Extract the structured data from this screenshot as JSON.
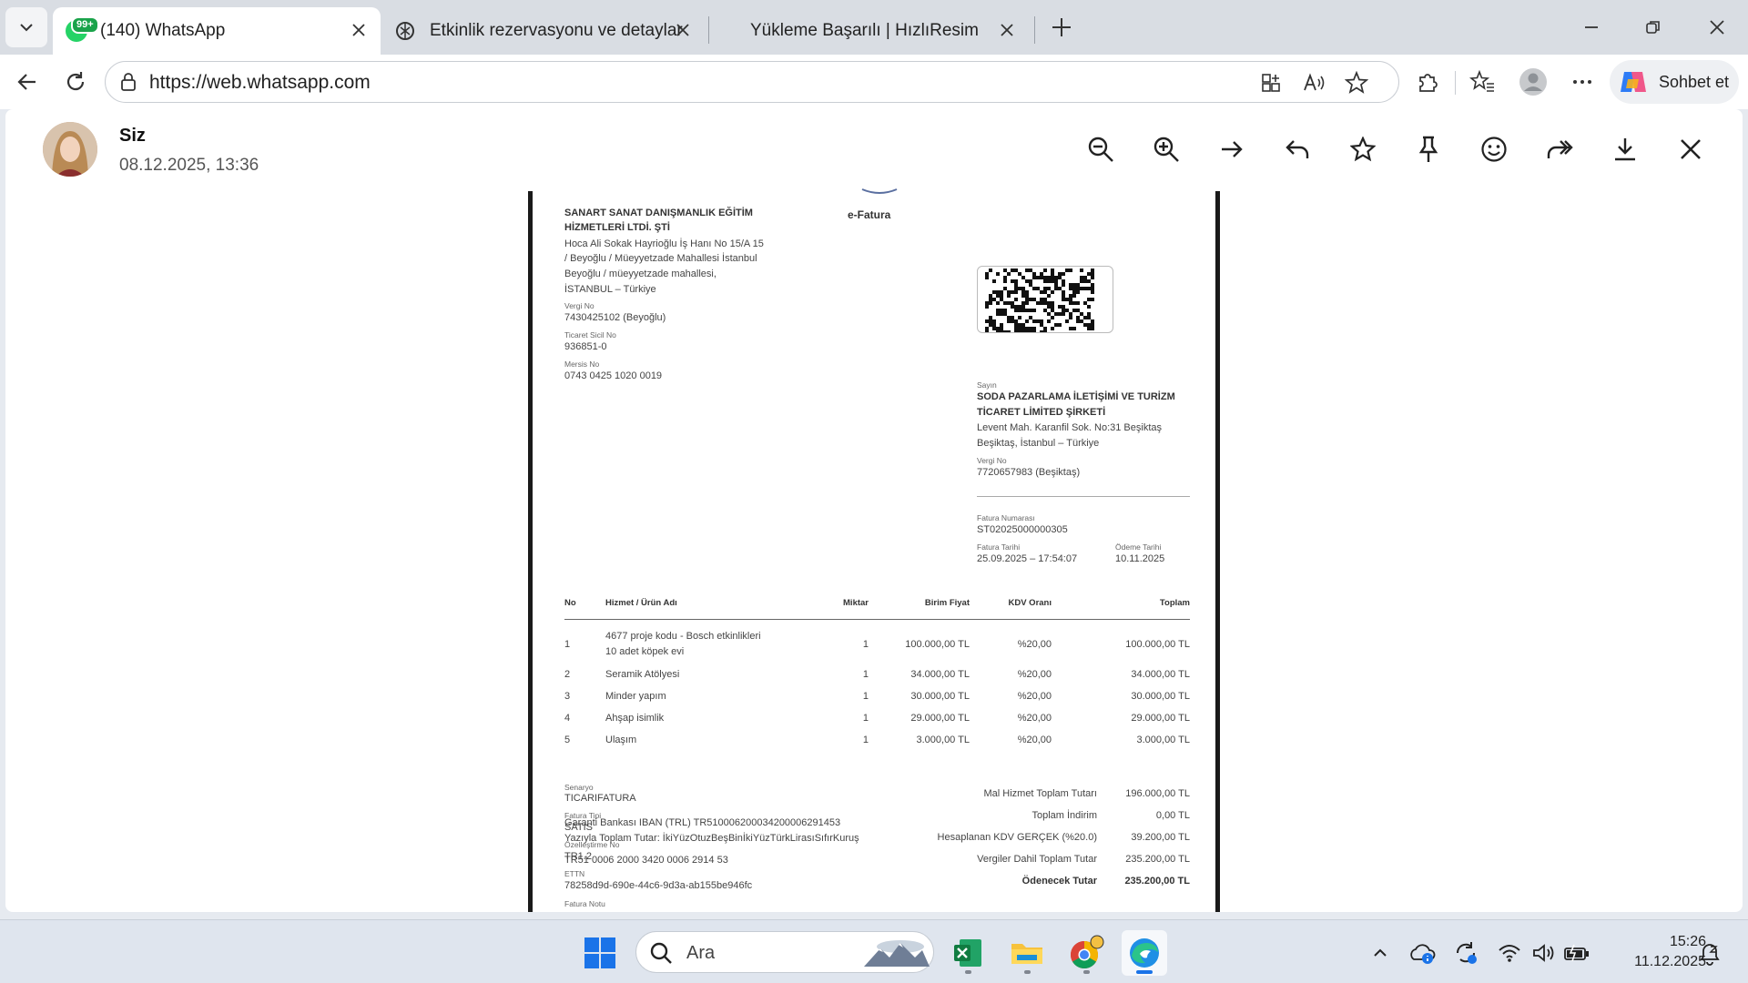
{
  "browser": {
    "tabs": [
      {
        "label": "(140) WhatsApp",
        "badge": "99+",
        "active": true
      },
      {
        "label": "Etkinlik rezervasyonu ve detaylar",
        "active": false
      },
      {
        "label": "Yükleme Başarılı | HızlıResim",
        "active": false
      }
    ],
    "url": "https://web.whatsapp.com",
    "copilot_label": "Sohbet et"
  },
  "viewer": {
    "sender": "Siz",
    "timestamp": "08.12.2025, 13:36"
  },
  "invoice": {
    "seller_lines": [
      "SANART SANAT DANIŞMANLIK EĞİTİM",
      "HİZMETLERİ LTDİ. ŞTİ"
    ],
    "seller_address": [
      "Hoca Ali Sokak Hayrioğlu İş Hanı No 15/A 15",
      "/ Beyoğlu / Müeyyetzade Mahallesi İstanbul",
      "Beyoğlu / müeyyetzade mahallesi,",
      "İSTANBUL – Türkiye"
    ],
    "vergi_no_label": "Vergi No",
    "vergi_no": "7430425102 (Beyoğlu)",
    "ticaret_label": "Ticaret Sicil No",
    "ticaret": "936851-0",
    "mersis_label": "Mersis No",
    "mersis": "0743 0425 1020 0019",
    "efatura": "e-Fatura",
    "sayin_label": "Sayın",
    "buyer_lines": [
      "SODA PAZARLAMA İLETİŞİMİ VE TURİZM",
      "TİCARET LİMİTED ŞİRKETİ"
    ],
    "buyer_address": [
      "Levent Mah. Karanfil Sok. No:31 Beşiktaş",
      "Beşiktaş, İstanbul – Türkiye"
    ],
    "buyer_vergi_label": "Vergi No",
    "buyer_vergi": "7720657983 (Beşiktaş)",
    "fatura_no_label": "Fatura Numarası",
    "fatura_no": "ST02025000000305",
    "fatura_tarihi_label": "Fatura Tarihi",
    "fatura_tarihi": "25.09.2025 – 17:54:07",
    "odeme_label": "Ödeme Tarihi",
    "odeme": "10.11.2025",
    "columns": [
      "No",
      "Hizmet / Ürün Adı",
      "Miktar",
      "Birim Fiyat",
      "KDV Oranı",
      "Toplam"
    ],
    "rows": [
      {
        "no": "1",
        "name": "4677 proje kodu - Bosch etkinlikleri",
        "name2": "10 adet köpek evi",
        "qty": "1",
        "price": "100.000,00 TL",
        "kdv": "%20,00",
        "total": "100.000,00 TL"
      },
      {
        "no": "2",
        "name": "Seramik Atölyesi",
        "name2": "",
        "qty": "1",
        "price": "34.000,00 TL",
        "kdv": "%20,00",
        "total": "34.000,00 TL"
      },
      {
        "no": "3",
        "name": "Minder yapım",
        "name2": "",
        "qty": "1",
        "price": "30.000,00 TL",
        "kdv": "%20,00",
        "total": "30.000,00 TL"
      },
      {
        "no": "4",
        "name": "Ahşap isimlik",
        "name2": "",
        "qty": "1",
        "price": "29.000,00 TL",
        "kdv": "%20,00",
        "total": "29.000,00 TL"
      },
      {
        "no": "5",
        "name": "Ulaşım",
        "name2": "",
        "qty": "1",
        "price": "3.000,00 TL",
        "kdv": "%20,00",
        "total": "3.000,00 TL"
      }
    ],
    "meta": [
      {
        "label": "Senaryo",
        "value": "TICARIFATURA"
      },
      {
        "label": "Fatura Tipi",
        "value": "SATIS"
      },
      {
        "label": "Özelleştirme No",
        "value": "TR1.2"
      },
      {
        "label": "ETTN",
        "value": "78258d9d-690e-44c6-9d3a-ab155be946fc"
      }
    ],
    "totals": [
      {
        "label": "Mal Hizmet Toplam Tutarı",
        "value": "196.000,00 TL"
      },
      {
        "label": "Toplam İndirim",
        "value": "0,00 TL"
      },
      {
        "label": "Hesaplanan KDV GERÇEK (%20.0)",
        "value": "39.200,00 TL"
      },
      {
        "label": "Vergiler Dahil Toplam Tutar",
        "value": "235.200,00 TL"
      },
      {
        "label": "Ödenecek Tutar",
        "value": "235.200,00 TL"
      }
    ],
    "note_label": "Fatura Notu",
    "note_lines": [
      "Garanti Bankası IBAN (TRL) TR510006200034200006291453",
      "Yazıyla Toplam Tutar: İkiYüzOtuzBeşBinİkiYüzTürkLirasıSıfırKuruş"
    ],
    "iban_line": "TR51 0006 2000 3420 0006 2914 53"
  },
  "taskbar": {
    "search_label": "Ara",
    "time": "15:26",
    "date": "11.12.2025"
  },
  "colors": {
    "accent": "#25d366",
    "tabstrip": "#d9dde3",
    "taskbar": "#dfe5ee"
  }
}
